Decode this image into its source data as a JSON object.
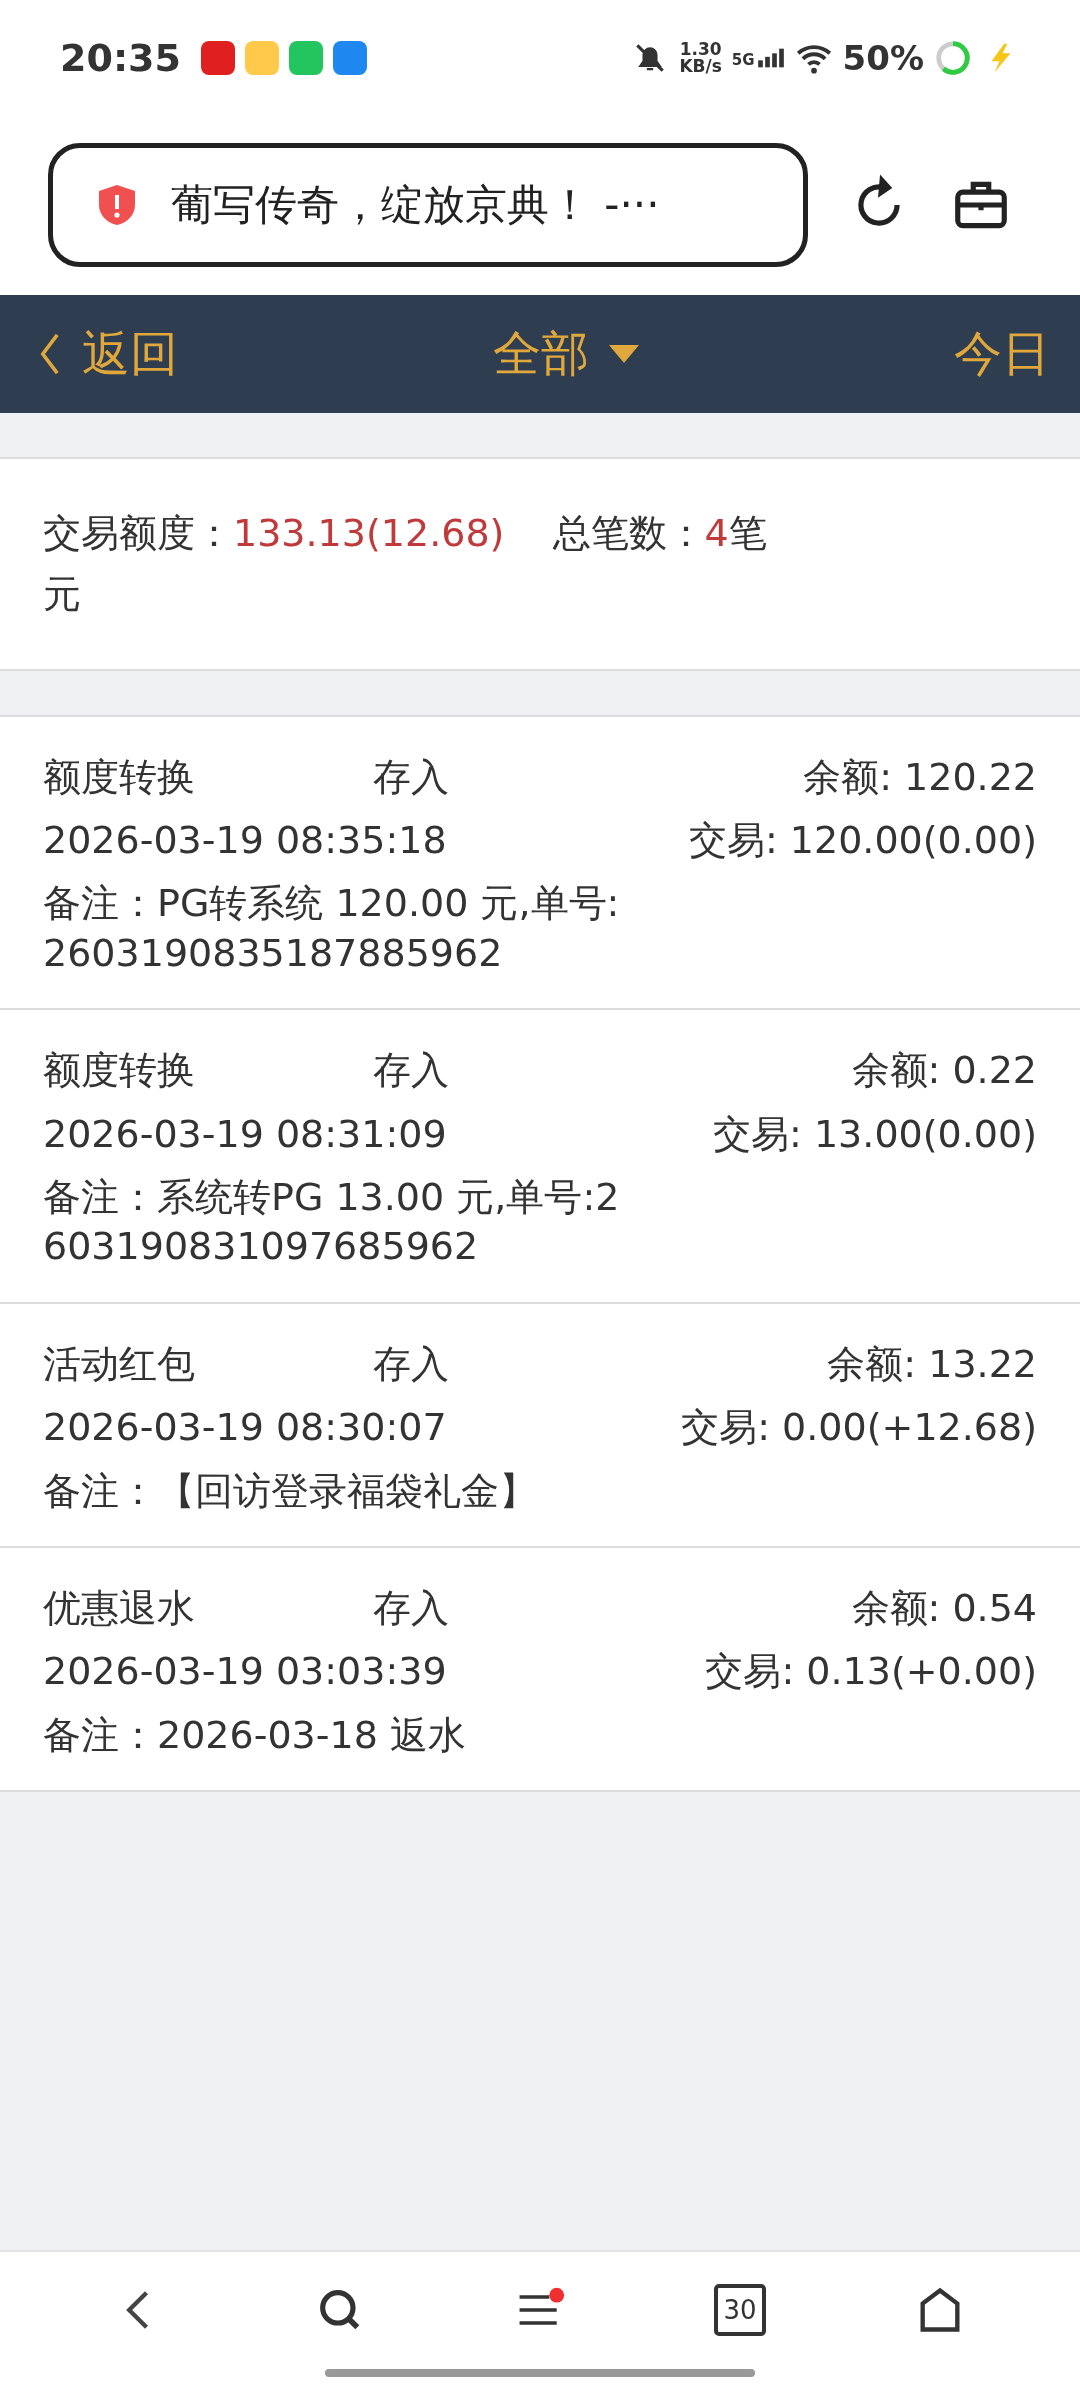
{
  "status_bar": {
    "time": "20:35",
    "net_speed": "1.30",
    "net_unit": "KB/s",
    "network": "5G",
    "battery": "50%"
  },
  "address_bar": {
    "text": "葡写传奇，绽放京典！ -···"
  },
  "nav": {
    "back": "返回",
    "filter": "全部",
    "today": "今日"
  },
  "summary": {
    "amount_label": "交易额度：",
    "amount": "133.13(12.68)",
    "count_label": "总笔数：",
    "count": "4",
    "count_unit": "笔",
    "amount_unit": "元"
  },
  "records": [
    {
      "type": "额度转换",
      "direction": "存入",
      "balance": "余额: 120.22",
      "time": "2026-03-19 08:35:18",
      "trade": "交易: 120.00(0.00)",
      "note": "备注：PG转系统 120.00 元,单号:2603190835187885962"
    },
    {
      "type": "额度转换",
      "direction": "存入",
      "balance": "余额: 0.22",
      "time": "2026-03-19 08:31:09",
      "trade": "交易: 13.00(0.00)",
      "note": "备注：系统转PG 13.00 元,单号:2603190831097685962"
    },
    {
      "type": "活动红包",
      "direction": "存入",
      "balance": "余额: 13.22",
      "time": "2026-03-19 08:30:07",
      "trade": "交易: 0.00(+12.68)",
      "note": "备注：【回访登录福袋礼金】"
    },
    {
      "type": "优惠退水",
      "direction": "存入",
      "balance": "余额: 0.54",
      "time": "2026-03-19 03:03:39",
      "trade": "交易: 0.13(+0.00)",
      "note": "备注：2026-03-18 返水"
    }
  ],
  "bottom_nav": {
    "tabs_count": "30",
    "menu_badge": true
  }
}
